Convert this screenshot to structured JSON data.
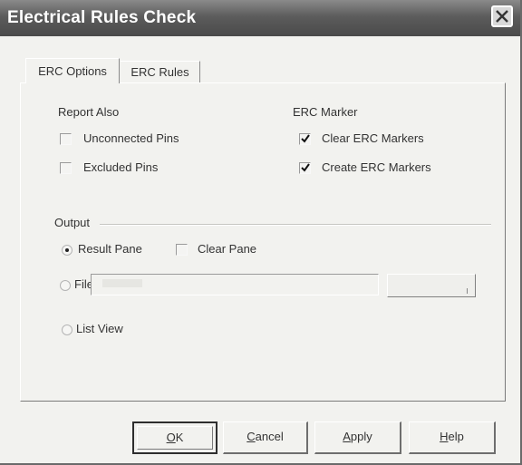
{
  "window": {
    "title": "Electrical Rules Check"
  },
  "tabs": [
    {
      "label": "ERC Options",
      "active": true
    },
    {
      "label": "ERC Rules",
      "active": false
    }
  ],
  "report_also": {
    "heading": "Report Also",
    "options": [
      {
        "label": "Unconnected Pins",
        "checked": false
      },
      {
        "label": "Excluded Pins",
        "checked": false
      }
    ]
  },
  "erc_marker": {
    "heading": "ERC Marker",
    "options": [
      {
        "label": "Clear ERC Markers",
        "checked": true
      },
      {
        "label": "Create ERC Markers",
        "checked": true
      }
    ]
  },
  "output": {
    "heading": "Output",
    "result_pane": {
      "label": "Result Pane",
      "selected": true
    },
    "clear_pane": {
      "label": "Clear Pane",
      "checked": false
    },
    "file": {
      "label": "File",
      "selected": false,
      "value": ""
    },
    "list_view": {
      "label": "List View",
      "selected": false
    }
  },
  "buttons": {
    "ok": {
      "accel": "O",
      "rest": "K"
    },
    "cancel": {
      "accel": "C",
      "rest": "ancel"
    },
    "apply": {
      "accel": "A",
      "rest": "pply"
    },
    "help": {
      "accel": "H",
      "rest": "elp"
    }
  },
  "icons": {
    "close": "close-icon",
    "check": "checkmark-icon"
  }
}
